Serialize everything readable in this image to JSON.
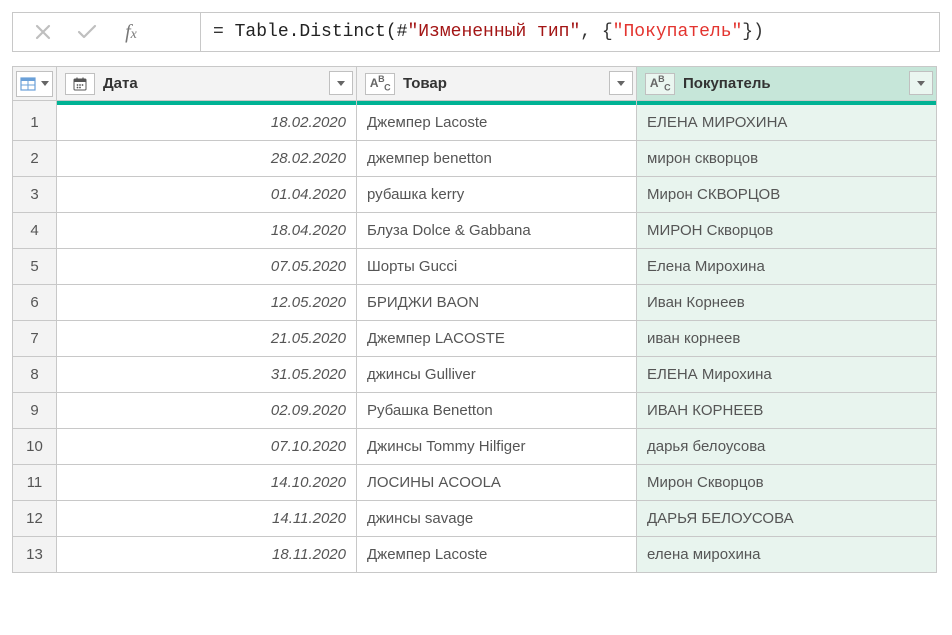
{
  "formula": {
    "prefix": "= ",
    "func_head": "Table.Distinct(#",
    "arg1": "\"Измененный тип\"",
    "sep": ", {",
    "arg2": "\"Покупатель\"",
    "tail": "})"
  },
  "columns": {
    "c1": "Дата",
    "c2": "Товар",
    "c3": "Покупатель"
  },
  "rows": [
    {
      "n": "1",
      "date": "18.02.2020",
      "product": "Джемпер Lacoste",
      "buyer": "ЕЛЕНА МИРОХИНА"
    },
    {
      "n": "2",
      "date": "28.02.2020",
      "product": "джемпер benetton",
      "buyer": "мирон скворцов"
    },
    {
      "n": "3",
      "date": "01.04.2020",
      "product": "рубашка kerry",
      "buyer": "Мирон СКВОРЦОВ"
    },
    {
      "n": "4",
      "date": "18.04.2020",
      "product": "Блуза Dolce & Gabbana",
      "buyer": "МИРОН Скворцов"
    },
    {
      "n": "5",
      "date": "07.05.2020",
      "product": "Шорты Gucci",
      "buyer": "Елена Мирохина"
    },
    {
      "n": "6",
      "date": "12.05.2020",
      "product": "БРИДЖИ BAON",
      "buyer": "Иван Корнеев"
    },
    {
      "n": "7",
      "date": "21.05.2020",
      "product": "Джемпер LACOSTE",
      "buyer": "иван корнеев"
    },
    {
      "n": "8",
      "date": "31.05.2020",
      "product": "джинсы Gulliver",
      "buyer": "ЕЛЕНА Мирохина"
    },
    {
      "n": "9",
      "date": "02.09.2020",
      "product": "Рубашка Benetton",
      "buyer": "ИВАН КОРНЕЕВ"
    },
    {
      "n": "10",
      "date": "07.10.2020",
      "product": "Джинсы Tommy Hilfiger",
      "buyer": "дарья белоусова"
    },
    {
      "n": "11",
      "date": "14.10.2020",
      "product": "ЛОСИНЫ ACOOLA",
      "buyer": "Мирон Скворцов"
    },
    {
      "n": "12",
      "date": "14.11.2020",
      "product": "джинсы savage",
      "buyer": "ДАРЬЯ БЕЛОУСОВА"
    },
    {
      "n": "13",
      "date": "18.11.2020",
      "product": "Джемпер Lacoste",
      "buyer": "елена мирохина"
    }
  ],
  "chart_data": {
    "type": "table",
    "columns": [
      "Дата",
      "Товар",
      "Покупатель"
    ],
    "rows": [
      [
        "18.02.2020",
        "Джемпер Lacoste",
        "ЕЛЕНА МИРОХИНА"
      ],
      [
        "28.02.2020",
        "джемпер benetton",
        "мирон скворцов"
      ],
      [
        "01.04.2020",
        "рубашка kerry",
        "Мирон СКВОРЦОВ"
      ],
      [
        "18.04.2020",
        "Блуза Dolce & Gabbana",
        "МИРОН Скворцов"
      ],
      [
        "07.05.2020",
        "Шорты Gucci",
        "Елена Мирохина"
      ],
      [
        "12.05.2020",
        "БРИДЖИ BAON",
        "Иван Корнеев"
      ],
      [
        "21.05.2020",
        "Джемпер LACOSTE",
        "иван корнеев"
      ],
      [
        "31.05.2020",
        "джинсы Gulliver",
        "ЕЛЕНА Мирохина"
      ],
      [
        "02.09.2020",
        "Рубашка Benetton",
        "ИВАН КОРНЕЕВ"
      ],
      [
        "07.10.2020",
        "Джинсы Tommy Hilfiger",
        "дарья белоусова"
      ],
      [
        "14.10.2020",
        "ЛОСИНЫ ACOOLA",
        "Мирон Скворцов"
      ],
      [
        "14.11.2020",
        "джинсы savage",
        "ДАРЬЯ БЕЛОУСОВА"
      ],
      [
        "18.11.2020",
        "Джемпер Lacoste",
        "елена мирохина"
      ]
    ]
  }
}
